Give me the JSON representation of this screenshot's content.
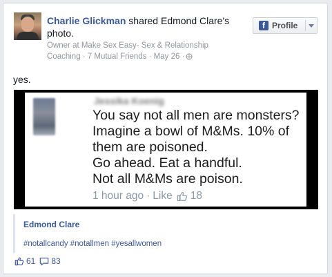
{
  "post": {
    "author": "Charlie Glickman",
    "action": "shared Edmond Clare's photo.",
    "meta_line1": "Owner at Make Sex Easy- Sex & Relationship",
    "meta_line2": "Coaching · 7 Mutual Friends · May 26 · ",
    "status_text": "yes.",
    "profile_button": "Profile"
  },
  "tweet": {
    "author": "Jessika Koenig",
    "text_lines": [
      "You say not all men are monsters?",
      "Imagine a bowl of M&Ms. 10% of",
      "them are poisoned.",
      "Go ahead. Eat a handful.",
      "Not all M&Ms are poison."
    ],
    "time": "1 hour ago",
    "like_label": "Like",
    "like_count": "18"
  },
  "shared_from": {
    "name": "Edmond Clare",
    "hashtags": "#notallcandy #notallmen #yesallwomen"
  },
  "stats": {
    "likes": "61",
    "comments": "83"
  },
  "icons": {
    "facebook": "facebook-f-icon",
    "chevron": "chevron-down-icon",
    "globe": "globe-icon",
    "thumb": "thumbs-up-icon",
    "comment": "comment-icon"
  },
  "colors": {
    "link": "#3b5998",
    "muted": "#90949c",
    "twitter_gray": "#8899a6"
  }
}
